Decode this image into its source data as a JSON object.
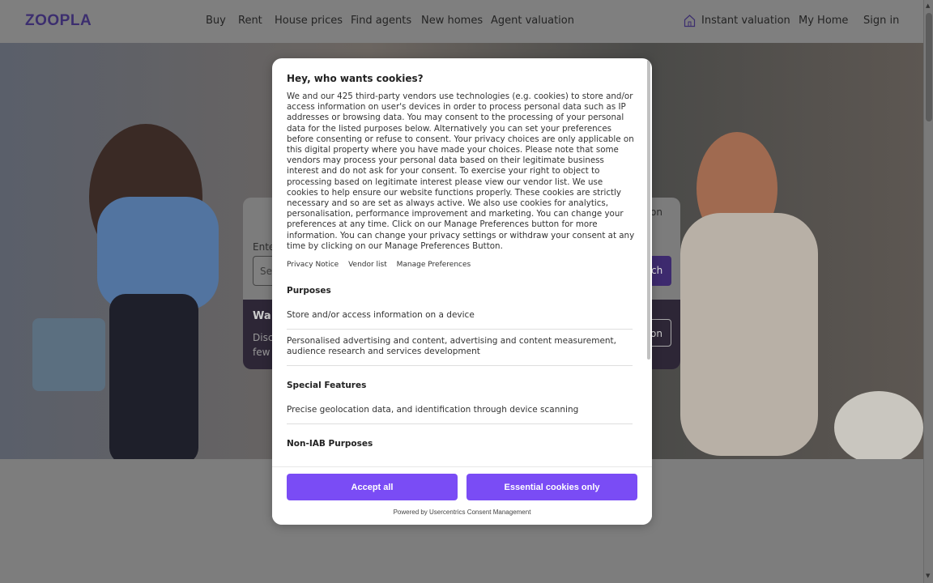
{
  "header": {
    "logo": "ZOOPLA",
    "nav": [
      "Buy",
      "Rent",
      "House prices",
      "Find agents",
      "New homes",
      "Agent valuation"
    ],
    "right": {
      "instant_valuation": "Instant valuation",
      "my_home": "My Home",
      "sign_in": "Sign in"
    }
  },
  "search_card": {
    "tab_right": "on",
    "label": "Ente",
    "input_placeholder": "Se",
    "button_label": "ch",
    "promo_title": "Wa",
    "promo_text_1": "Disc",
    "promo_text_2": "few",
    "promo_button": "on"
  },
  "modal": {
    "title": "Hey, who wants cookies?",
    "body": "We and our 425 third-party vendors use technologies (e.g. cookies) to store and/or access information on user's devices in order to process personal data such as IP addresses or browsing data. You may consent to the processing of your personal data for the listed purposes below. Alternatively you can set your preferences before consenting or refuse to consent. Your privacy choices are only applicable on this digital property where you have made your choices. Please note that some vendors may process your personal data based on their legitimate business interest and do not ask for your consent. To exercise your right to object to processing based on legitimate interest please view our vendor list. We use cookies to help ensure our website functions properly. These cookies are strictly necessary and so are set as always active. We also use cookies for analytics, personalisation, performance improvement and marketing. You can change your preferences at any time. Click on our Manage Preferences button for more information. You can change your privacy settings or withdraw your consent at any time by clicking on our Manage Preferences Button.",
    "links": [
      "Privacy Notice",
      "Vendor list",
      "Manage Preferences"
    ],
    "sections": {
      "purposes_title": "Purposes",
      "purposes": [
        "Store and/or access information on a device",
        "Personalised advertising and content, advertising and content measurement, audience research and services development"
      ],
      "special_features_title": "Special Features",
      "special_features": [
        "Precise geolocation data, and identification through device scanning"
      ],
      "non_iab_title": "Non-IAB Purposes"
    },
    "buttons": {
      "accept_all": "Accept all",
      "essential_only": "Essential cookies only"
    },
    "powered_by": "Powered by Usercentrics Consent Management"
  },
  "colors": {
    "brand": "#3c2e6f",
    "accent": "#7a4cf5",
    "overlay": "#7f7f7f"
  }
}
